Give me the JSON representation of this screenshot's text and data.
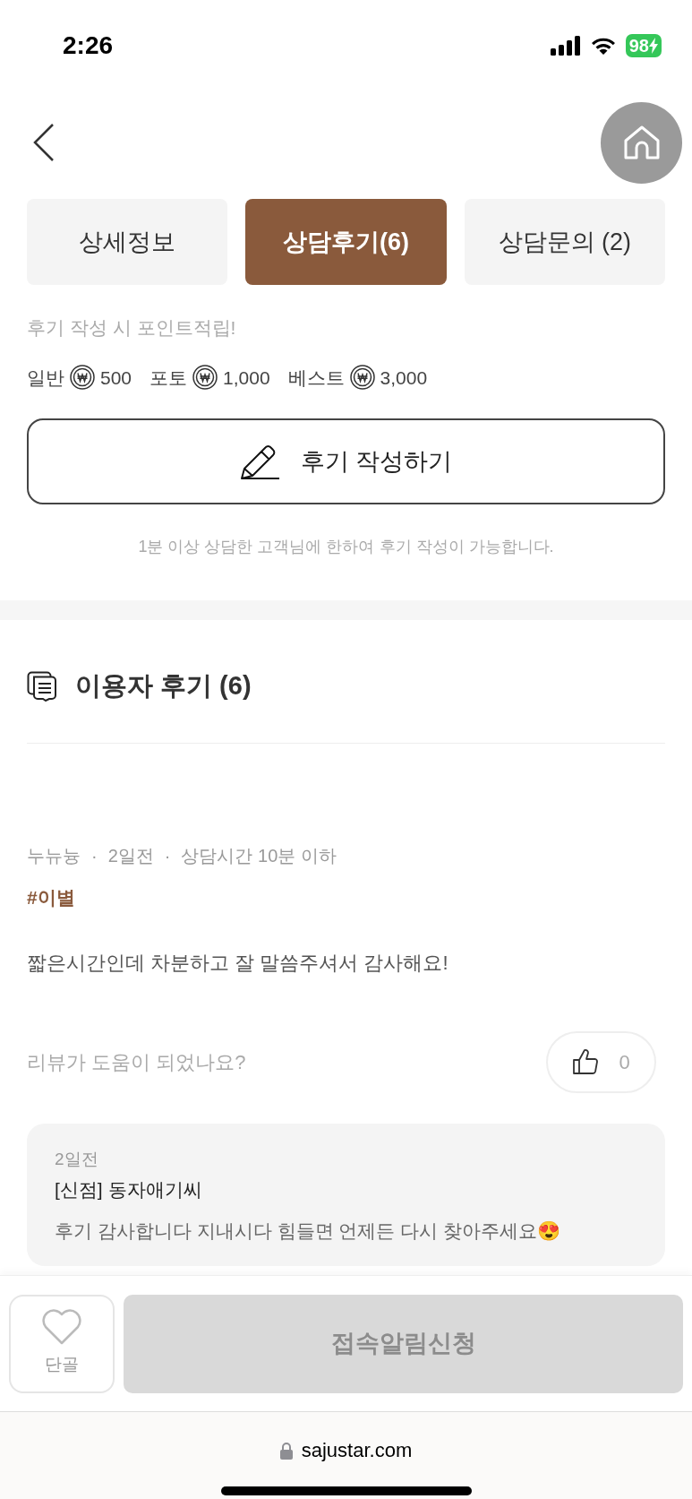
{
  "status_bar": {
    "time": "2:26",
    "battery": "98"
  },
  "tabs": [
    {
      "label": "상세정보",
      "selected": false
    },
    {
      "label": "상담후기(6)",
      "selected": true
    },
    {
      "label": "상담문의 (2)",
      "selected": false
    }
  ],
  "notice": {
    "subtitle": "후기 작성 시 포인트적립!",
    "points": [
      {
        "label": "일반",
        "amount": "500"
      },
      {
        "label": "포토",
        "amount": "1,000"
      },
      {
        "label": "베스트",
        "amount": "3,000"
      }
    ]
  },
  "write_button": "후기 작성하기",
  "write_note": "1분 이상 상담한 고객님에 한하여 후기 작성이 가능합니다.",
  "reviews_section": {
    "title": "이용자 후기 (6)",
    "reviews": [
      {
        "separator": "·",
        "author": "누뉴늉",
        "date": "2일전",
        "duration": "상담시간 10분 이하",
        "tag": "#이별",
        "body": "짧은시간인데 차분하고 잘 말씀주셔서 감사해요!",
        "helpful_prompt": "리뷰가 도움이 되었나요?",
        "likes": "0",
        "reply": {
          "date": "2일전",
          "author": "[신점] 동자애기씨",
          "body": "후기 감사합니다 지내시다 힘들면 언제든 다시 찾아주세요😍"
        }
      }
    ]
  },
  "bottom_bar": {
    "favorite_label": "단골",
    "notify_button": "접속알림신청"
  },
  "browser": {
    "url": "sajustar.com"
  }
}
